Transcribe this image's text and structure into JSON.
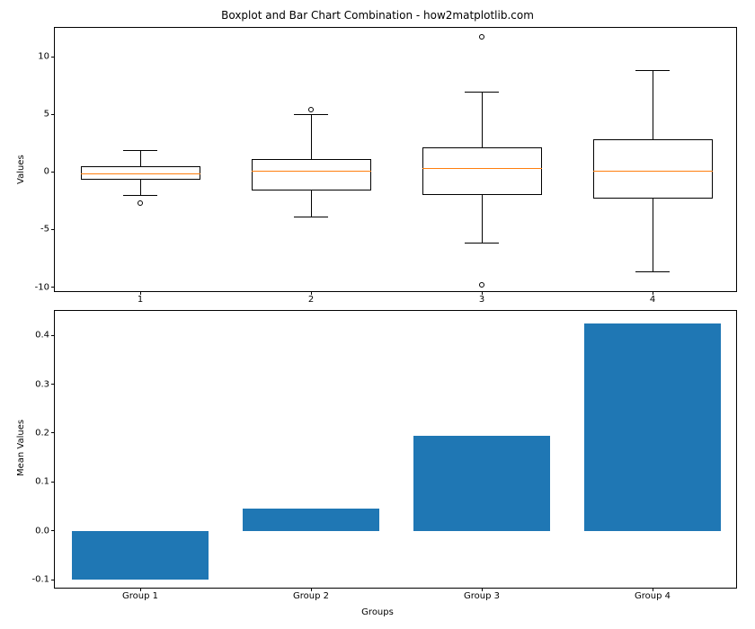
{
  "title": "Boxplot and Bar Chart Combination - how2matplotlib.com",
  "xlabel": "Groups",
  "top": {
    "ylabel": "Values",
    "ylim": [
      -10.5,
      12.5
    ],
    "yticks": [
      -10,
      -5,
      0,
      5,
      10
    ],
    "xticks_idx": [
      1,
      2,
      3,
      4
    ],
    "xtick_labels": [
      "1",
      "2",
      "3",
      "4"
    ]
  },
  "bottom": {
    "ylabel": "Mean Values",
    "ylim": [
      -0.12,
      0.45
    ],
    "yticks": [
      -0.1,
      0.0,
      0.1,
      0.2,
      0.3,
      0.4
    ],
    "xtick_labels": [
      "Group 1",
      "Group 2",
      "Group 3",
      "Group 4"
    ]
  },
  "chart_data": [
    {
      "type": "boxplot",
      "title": "Boxplot and Bar Chart Combination - how2matplotlib.com",
      "ylabel": "Values",
      "categories": [
        "1",
        "2",
        "3",
        "4"
      ],
      "ylim": [
        -10.5,
        12.5
      ],
      "series": [
        {
          "name": "Group 1",
          "q1": -0.7,
          "median": -0.1,
          "q3": 0.5,
          "whisker_low": -2.0,
          "whisker_high": 1.9,
          "outliers": [
            -2.7
          ]
        },
        {
          "name": "Group 2",
          "q1": -1.6,
          "median": 0.1,
          "q3": 1.1,
          "whisker_low": -3.9,
          "whisker_high": 5.0,
          "outliers": [
            5.4
          ]
        },
        {
          "name": "Group 3",
          "q1": -2.0,
          "median": 0.3,
          "q3": 2.1,
          "whisker_low": -6.1,
          "whisker_high": 7.0,
          "outliers": [
            -9.8,
            11.7
          ]
        },
        {
          "name": "Group 4",
          "q1": -2.3,
          "median": 0.1,
          "q3": 2.8,
          "whisker_low": -8.6,
          "whisker_high": 8.8,
          "outliers": []
        }
      ]
    },
    {
      "type": "bar",
      "xlabel": "Groups",
      "ylabel": "Mean Values",
      "categories": [
        "Group 1",
        "Group 2",
        "Group 3",
        "Group 4"
      ],
      "ylim": [
        -0.12,
        0.45
      ],
      "values": [
        -0.1,
        0.045,
        0.195,
        0.425
      ]
    }
  ]
}
